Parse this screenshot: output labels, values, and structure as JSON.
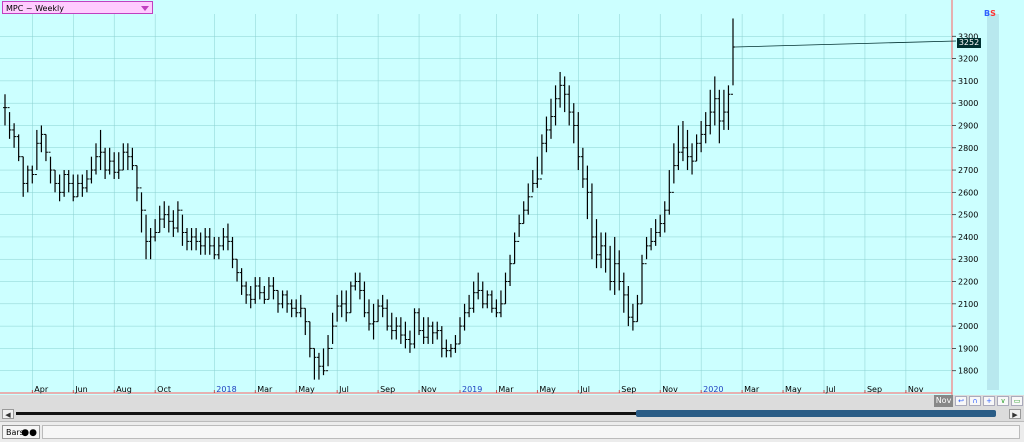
{
  "symbol": {
    "label": "MPC ~ Weekly"
  },
  "badge": {
    "b": "B",
    "s": "S"
  },
  "price_tag": "3252",
  "scroll": {
    "left_arrow": "◀",
    "right_arrow": "▶",
    "nov_tab": "Nov"
  },
  "toolbar": {
    "icons": [
      "restore-icon",
      "trend-icon",
      "zoom-in-icon",
      "zoom-out-icon",
      "calendar-icon"
    ]
  },
  "bottom": {
    "bars_label": "Bars"
  },
  "colors": {
    "background": "#ccffff",
    "bar": "#000000",
    "grid": "#8ad0d0"
  },
  "chart_data": {
    "type": "ohlc",
    "title": "MPC ~ Weekly",
    "ylim": [
      1700,
      3400
    ],
    "y_ticks": [
      1800,
      1900,
      2000,
      2100,
      2200,
      2300,
      2400,
      2500,
      2600,
      2700,
      2800,
      2900,
      3000,
      3100,
      3200,
      3300
    ],
    "x_ticks": [
      {
        "label": "Apr",
        "i": 6
      },
      {
        "label": "Jun",
        "i": 15
      },
      {
        "label": "Aug",
        "i": 24
      },
      {
        "label": "Oct",
        "i": 33
      },
      {
        "label": "2018",
        "i": 46
      },
      {
        "label": "Mar",
        "i": 55
      },
      {
        "label": "May",
        "i": 64
      },
      {
        "label": "Jul",
        "i": 73
      },
      {
        "label": "Sep",
        "i": 82
      },
      {
        "label": "Nov",
        "i": 91
      },
      {
        "label": "2019",
        "i": 100
      },
      {
        "label": "Mar",
        "i": 108
      },
      {
        "label": "May",
        "i": 117
      },
      {
        "label": "Jul",
        "i": 126
      },
      {
        "label": "Sep",
        "i": 135
      },
      {
        "label": "Nov",
        "i": 144
      },
      {
        "label": "2020",
        "i": 153
      },
      {
        "label": "Mar",
        "i": 162
      },
      {
        "label": "May",
        "i": 171
      },
      {
        "label": "Jul",
        "i": 180
      },
      {
        "label": "Sep",
        "i": 189
      },
      {
        "label": "Nov",
        "i": 198
      }
    ],
    "grid": true,
    "last_price": 3252,
    "close": [
      2980,
      2880,
      2850,
      2760,
      2640,
      2700,
      2680,
      2820,
      2860,
      2780,
      2700,
      2640,
      2600,
      2680,
      2640,
      2580,
      2640,
      2620,
      2660,
      2700,
      2760,
      2780,
      2700,
      2740,
      2690,
      2700,
      2780,
      2760,
      2720,
      2620,
      2520,
      2380,
      2400,
      2420,
      2480,
      2500,
      2470,
      2440,
      2520,
      2420,
      2380,
      2400,
      2380,
      2360,
      2400,
      2360,
      2320,
      2360,
      2400,
      2380,
      2300,
      2240,
      2180,
      2140,
      2120,
      2180,
      2150,
      2120,
      2180,
      2160,
      2100,
      2140,
      2100,
      2080,
      2060,
      2080,
      2020,
      1900,
      1860,
      1820,
      1800,
      1900,
      2000,
      2090,
      2100,
      2060,
      2180,
      2200,
      2160,
      2060,
      2010,
      2020,
      2090,
      2080,
      2000,
      1980,
      2000,
      1960,
      1940,
      1920,
      2060,
      1980,
      1950,
      2000,
      1970,
      1980,
      1900,
      1890,
      1900,
      1920,
      2000,
      2060,
      2080,
      2150,
      2160,
      2100,
      2140,
      2080,
      2060,
      2100,
      2200,
      2280,
      2380,
      2460,
      2520,
      2580,
      2640,
      2660,
      2820,
      2880,
      2940,
      3020,
      3080,
      3040,
      2960,
      2900,
      2760,
      2660,
      2600,
      2400,
      2320,
      2360,
      2300,
      2200,
      2280,
      2200,
      2140,
      2040,
      2020,
      2100,
      2280,
      2360,
      2380,
      2420,
      2460,
      2520,
      2600,
      2720,
      2780,
      2800,
      2760,
      2740,
      2820,
      2860,
      2900,
      2960,
      3020,
      2920,
      2960,
      3040,
      3252
    ],
    "high": [
      3040,
      2960,
      2910,
      2860,
      2760,
      2720,
      2720,
      2880,
      2900,
      2860,
      2760,
      2700,
      2680,
      2700,
      2700,
      2680,
      2680,
      2680,
      2700,
      2760,
      2820,
      2880,
      2800,
      2800,
      2780,
      2780,
      2820,
      2820,
      2800,
      2720,
      2600,
      2500,
      2440,
      2480,
      2540,
      2560,
      2540,
      2520,
      2560,
      2500,
      2440,
      2440,
      2440,
      2420,
      2440,
      2440,
      2400,
      2400,
      2440,
      2460,
      2400,
      2300,
      2260,
      2200,
      2180,
      2220,
      2220,
      2180,
      2220,
      2220,
      2160,
      2160,
      2160,
      2120,
      2120,
      2140,
      2080,
      2020,
      1900,
      1880,
      1900,
      1960,
      2060,
      2140,
      2160,
      2160,
      2200,
      2240,
      2240,
      2200,
      2120,
      2100,
      2120,
      2140,
      2120,
      2060,
      2040,
      2040,
      2020,
      1980,
      2080,
      2080,
      2040,
      2040,
      2020,
      2020,
      2000,
      1940,
      1920,
      1960,
      2040,
      2100,
      2140,
      2200,
      2240,
      2200,
      2160,
      2160,
      2120,
      2160,
      2240,
      2320,
      2420,
      2500,
      2560,
      2640,
      2700,
      2760,
      2860,
      2940,
      3020,
      3080,
      3140,
      3120,
      3080,
      3000,
      2960,
      2800,
      2720,
      2640,
      2480,
      2420,
      2420,
      2360,
      2400,
      2340,
      2240,
      2180,
      2100,
      2140,
      2320,
      2400,
      2440,
      2480,
      2500,
      2560,
      2700,
      2820,
      2900,
      2920,
      2880,
      2820,
      2860,
      2920,
      2960,
      3060,
      3120,
      3060,
      3060,
      3080,
      3380
    ],
    "low": [
      2900,
      2840,
      2800,
      2740,
      2580,
      2600,
      2640,
      2700,
      2780,
      2740,
      2640,
      2600,
      2560,
      2580,
      2600,
      2560,
      2580,
      2580,
      2600,
      2640,
      2680,
      2700,
      2660,
      2680,
      2660,
      2660,
      2700,
      2700,
      2700,
      2560,
      2420,
      2300,
      2300,
      2380,
      2420,
      2440,
      2420,
      2400,
      2420,
      2360,
      2340,
      2340,
      2340,
      2320,
      2320,
      2320,
      2300,
      2300,
      2340,
      2340,
      2260,
      2200,
      2140,
      2100,
      2080,
      2100,
      2120,
      2100,
      2120,
      2120,
      2060,
      2080,
      2060,
      2040,
      2040,
      2040,
      1960,
      1860,
      1760,
      1760,
      1780,
      1820,
      1920,
      2020,
      2040,
      2020,
      2060,
      2160,
      2120,
      2040,
      1980,
      1940,
      2020,
      2040,
      1980,
      1940,
      1940,
      1920,
      1900,
      1880,
      1900,
      1960,
      1920,
      1920,
      1920,
      1940,
      1860,
      1860,
      1860,
      1880,
      1920,
      1980,
      2040,
      2060,
      2120,
      2080,
      2080,
      2060,
      2040,
      2040,
      2100,
      2180,
      2280,
      2400,
      2460,
      2500,
      2600,
      2620,
      2680,
      2780,
      2840,
      2900,
      2980,
      2960,
      2900,
      2820,
      2700,
      2620,
      2480,
      2300,
      2260,
      2260,
      2240,
      2160,
      2140,
      2160,
      2060,
      2000,
      1980,
      2020,
      2100,
      2300,
      2340,
      2360,
      2400,
      2420,
      2500,
      2640,
      2700,
      2740,
      2700,
      2680,
      2740,
      2780,
      2820,
      2860,
      2900,
      2820,
      2880,
      2880,
      3080
    ],
    "n_bars": 165
  }
}
